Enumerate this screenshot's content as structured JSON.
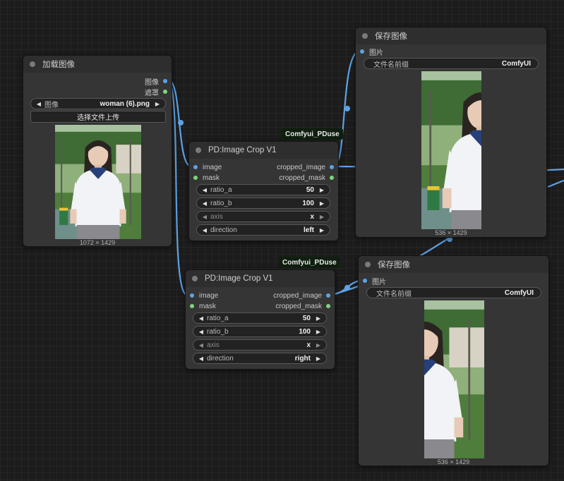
{
  "colors": {
    "canvas_bg": "#1c1c1c",
    "node_bg": "#353535",
    "image_wire": "#5da3e6",
    "mask_slot": "#7fd47f"
  },
  "load_image": {
    "title": "加载图像",
    "outputs": [
      "图像",
      "遮罩"
    ],
    "image_widget_label": "图像",
    "image_widget_value": "woman (6).png",
    "upload_label": "选择文件上传",
    "size_text": "1072 × 1429"
  },
  "crop1": {
    "badge": "Comfyui_PDuse",
    "title": "PD:Image Crop V1",
    "inputs": [
      "image",
      "mask"
    ],
    "outputs": [
      "cropped_image",
      "cropped_mask"
    ],
    "widgets": [
      {
        "label": "ratio_a",
        "value": "50"
      },
      {
        "label": "ratio_b",
        "value": "100"
      },
      {
        "label": "axis",
        "value": "x"
      },
      {
        "label": "direction",
        "value": "left"
      }
    ]
  },
  "crop2": {
    "badge": "Comfyui_PDuse",
    "title": "PD:Image Crop V1",
    "inputs": [
      "image",
      "mask"
    ],
    "outputs": [
      "cropped_image",
      "cropped_mask"
    ],
    "widgets": [
      {
        "label": "ratio_a",
        "value": "50"
      },
      {
        "label": "ratio_b",
        "value": "100"
      },
      {
        "label": "axis",
        "value": "x"
      },
      {
        "label": "direction",
        "value": "right"
      }
    ]
  },
  "save1": {
    "title": "保存图像",
    "input": "图片",
    "prefix_label": "文件名前缀",
    "prefix_value": "ComfyUI",
    "size_text": "536 × 1429"
  },
  "save2": {
    "title": "保存图像",
    "input": "图片",
    "prefix_label": "文件名前缀",
    "prefix_value": "ComfyUI",
    "size_text": "536 × 1429"
  }
}
